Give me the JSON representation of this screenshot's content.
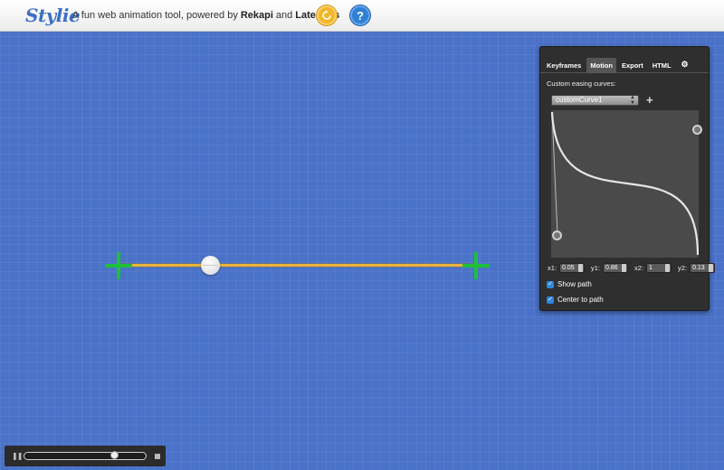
{
  "header": {
    "logo": "Stylie",
    "tagline_prefix": "A fun web animation tool, powered by",
    "tagline_link1": "Rekapi",
    "tagline_and": "and",
    "tagline_link2": "Lateralus",
    "reset_icon": "refresh-icon",
    "help_label": "?"
  },
  "panel": {
    "tabs": [
      "Keyframes",
      "Motion",
      "Export",
      "HTML"
    ],
    "active_tab": "Motion",
    "gear_icon": "⚙",
    "easing_label": "Custom easing curves:",
    "curve_name": "customCurve1",
    "add_label": "+",
    "params": [
      {
        "label": "x1:",
        "value": "0.05"
      },
      {
        "label": "y1:",
        "value": "0.86"
      },
      {
        "label": "x2:",
        "value": "1"
      },
      {
        "label": "y2:",
        "value": "0.13"
      }
    ],
    "show_path_label": "Show path",
    "show_path_checked": true,
    "center_path_label": "Center to path",
    "center_path_checked": true
  },
  "timeline": {
    "progress": 0.76,
    "pause_icon": "pause-icon",
    "stop_icon": "stop-icon"
  },
  "colors": {
    "background": "#4a72c8",
    "path": "#e8b43a",
    "crosshair": "#1fbf3a",
    "accent": "#2d86e0"
  }
}
